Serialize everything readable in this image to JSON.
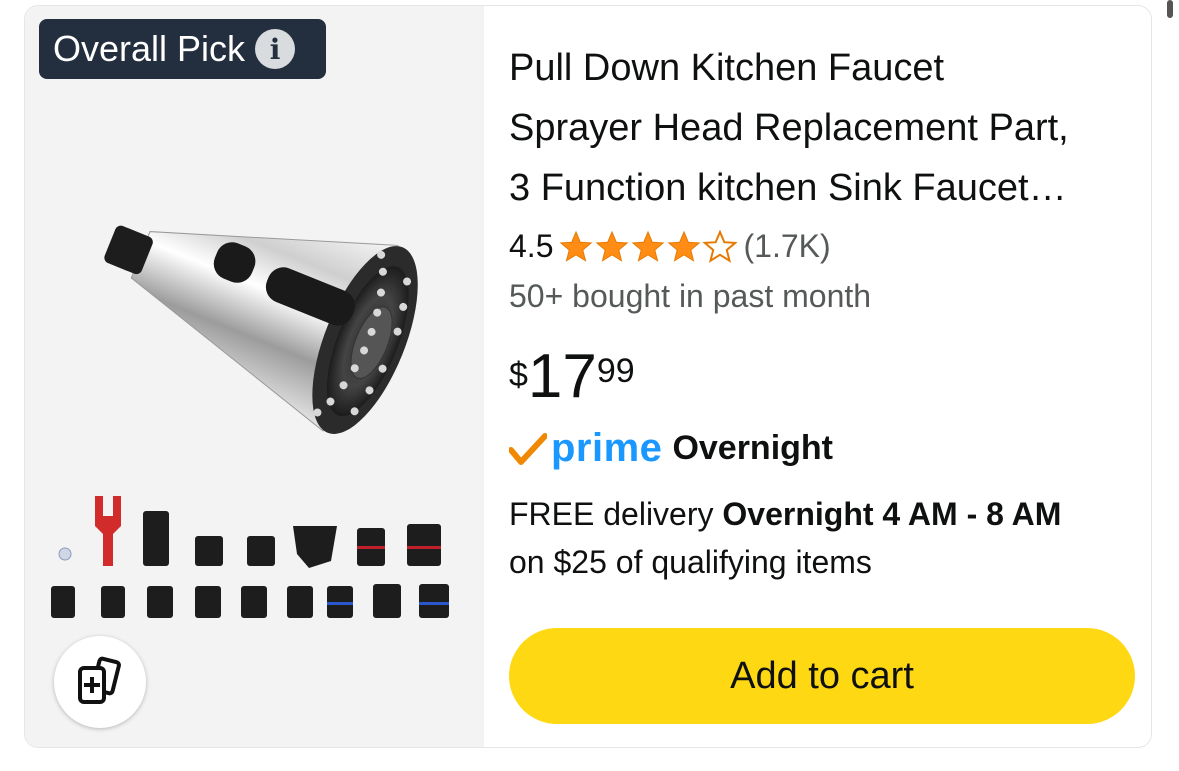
{
  "badge": {
    "label": "Overall Pick",
    "info_icon": "info-icon"
  },
  "product": {
    "title": "Pull Down Kitchen Faucet\nSprayer Head Replacement Part,\n3 Function kitchen Sink Faucet…",
    "rating_value": "4.5",
    "rating_stars": 4.5,
    "rating_count": "(1.7K)",
    "bought_text": "50+ bought in past month",
    "price": {
      "currency": "$",
      "whole": "17",
      "fraction": "99"
    },
    "prime": {
      "check_icon": "prime-check-icon",
      "word": "prime",
      "label": "Overnight"
    },
    "delivery": {
      "prefix": "FREE delivery ",
      "bold": "Overnight 4 AM - 8 AM",
      "suffix": "on $25 of qualifying items"
    },
    "add_to_cart_label": "Add to cart",
    "compare_icon": "compare-add-icon"
  },
  "colors": {
    "badge_bg": "#232f3e",
    "star": "#ff8c14",
    "prime_blue": "#1a98ff",
    "prime_check": "#f08804",
    "button_yellow": "#ffd814",
    "muted_text": "#565959"
  }
}
